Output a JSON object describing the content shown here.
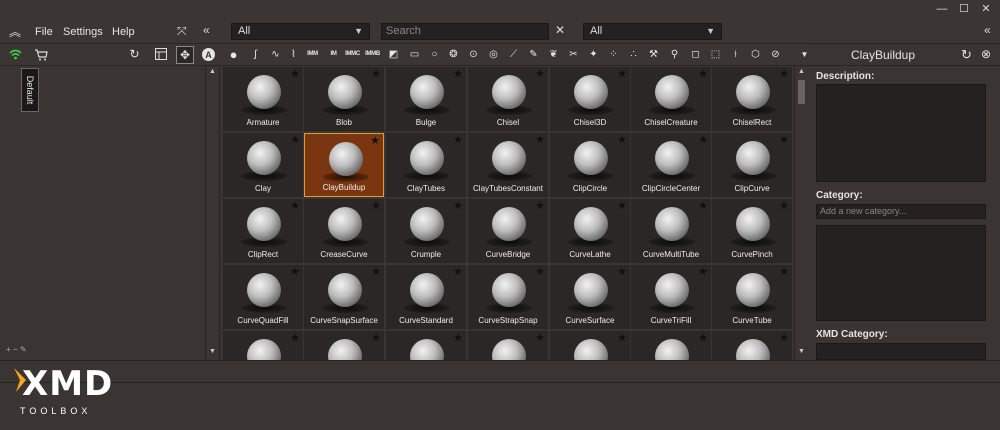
{
  "menu": {
    "file": "File",
    "settings": "Settings",
    "help": "Help"
  },
  "filters": {
    "left_select": "All",
    "search_placeholder": "Search",
    "right_select": "All"
  },
  "left_panel": {
    "tab": "Default"
  },
  "brushes": [
    {
      "name": "Armature"
    },
    {
      "name": "Blob"
    },
    {
      "name": "Bulge"
    },
    {
      "name": "Chisel"
    },
    {
      "name": "Chisel3D"
    },
    {
      "name": "ChiselCreature"
    },
    {
      "name": "ChiselRect"
    },
    {
      "name": "Clay"
    },
    {
      "name": "ClayBuildup",
      "selected": true
    },
    {
      "name": "ClayTubes"
    },
    {
      "name": "ClayTubesConstant"
    },
    {
      "name": "ClipCircle"
    },
    {
      "name": "ClipCircleCenter"
    },
    {
      "name": "ClipCurve"
    },
    {
      "name": "ClipRect"
    },
    {
      "name": "CreaseCurve"
    },
    {
      "name": "Crumple"
    },
    {
      "name": "CurveBridge"
    },
    {
      "name": "CurveLathe"
    },
    {
      "name": "CurveMultiTube"
    },
    {
      "name": "CurvePinch"
    },
    {
      "name": "CurveQuadFill"
    },
    {
      "name": "CurveSnapSurface"
    },
    {
      "name": "CurveStandard"
    },
    {
      "name": "CurveStrapSnap"
    },
    {
      "name": "CurveSurface"
    },
    {
      "name": "CurveTriFill"
    },
    {
      "name": "CurveTube"
    },
    {
      "name": ""
    },
    {
      "name": ""
    },
    {
      "name": ""
    },
    {
      "name": ""
    },
    {
      "name": ""
    },
    {
      "name": ""
    },
    {
      "name": ""
    }
  ],
  "right_panel": {
    "title": "ClayBuildup",
    "description_label": "Description:",
    "category_label": "Category:",
    "category_placeholder": "Add a new category...",
    "xmd_category_label": "XMD Category:"
  },
  "logo": {
    "main": "XMD",
    "sub": "TOOLBOX"
  },
  "colors": {
    "selected_bg": "#7a3610",
    "selected_border": "#e0a030",
    "wifi": "#3ccf3c"
  }
}
